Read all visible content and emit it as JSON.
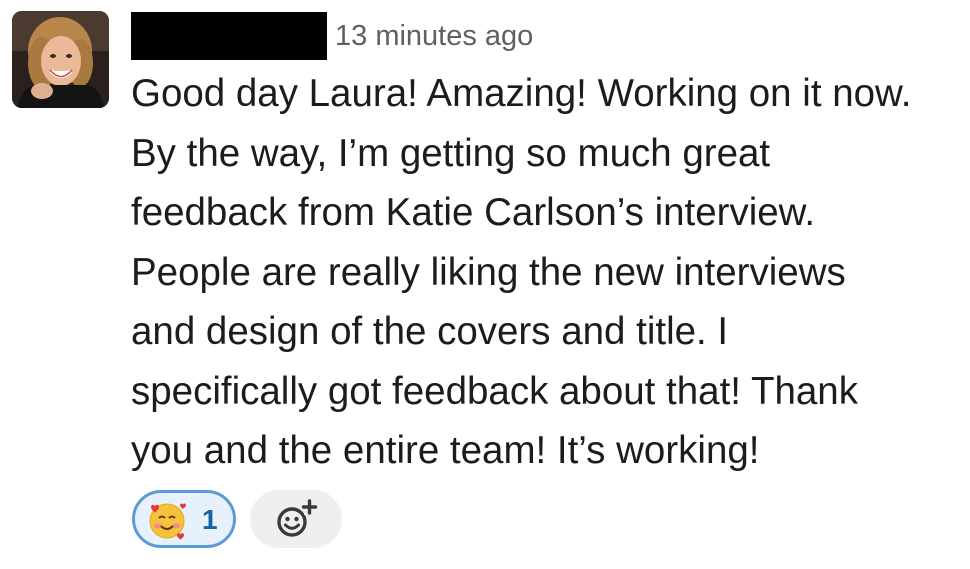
{
  "message": {
    "timestamp": "13 minutes ago",
    "body_lines": [
      "Good day Laura! Amazing! Working on it now.",
      "By the way, I’m getting so much great",
      "feedback from Katie Carlson’s interview.",
      "People are really liking the new interviews",
      "and design of the covers and title. I",
      "specifically got feedback about that! Thank",
      "you and the entire team! It’s working!"
    ],
    "reactions": [
      {
        "emoji": "smiling-face-with-hearts-icon",
        "count": "1",
        "selected": true
      }
    ],
    "add_reaction_icon": "add-reaction-icon"
  },
  "colors": {
    "text": "#1d1c1d",
    "timestamp": "#616061",
    "reaction_border": "#5b9bd5",
    "reaction_bg": "#e6f1fb",
    "reaction_count": "#1264a3",
    "add_reaction_bg": "#efefef"
  }
}
